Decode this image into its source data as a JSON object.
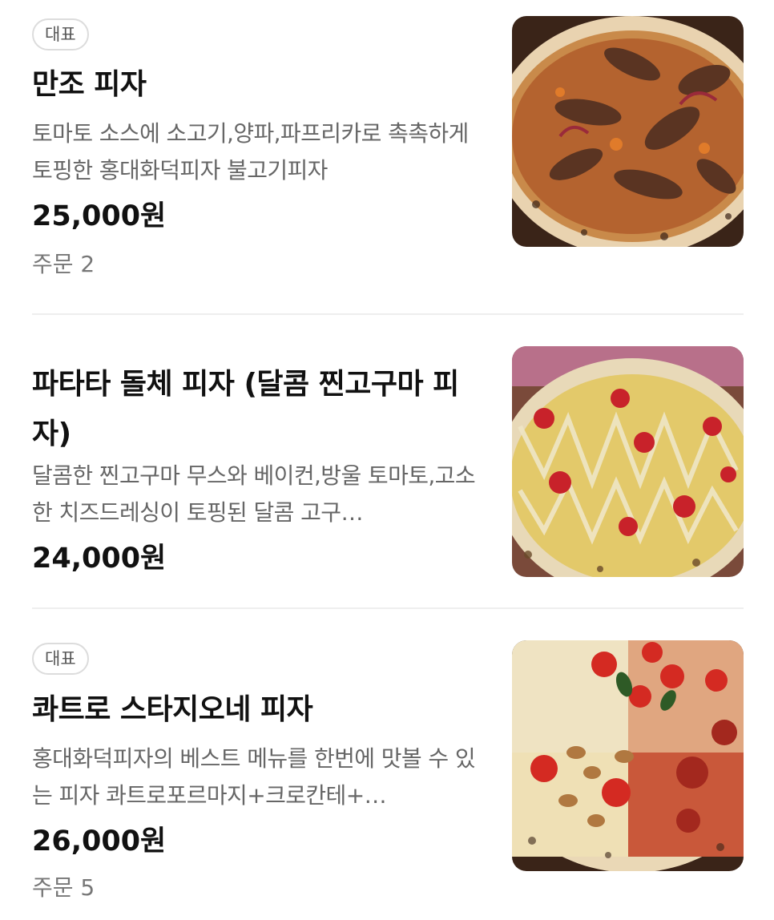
{
  "menu": {
    "items": [
      {
        "badge": "대표",
        "name": "만조 피자",
        "description": "토마토 소스에 소고기,양파,파프리카로 촉촉하게 토핑한 홍대화덕피자 불고기피자",
        "price": "25,000원",
        "orders": "주문 2",
        "image": "bulgogi-pizza-photo"
      },
      {
        "name": "파타타 돌체 피자 (달콤 찐고구마 피자)",
        "description": "달콤한 찐고구마 무스와 베이컨,방울 토마토,고소한 치즈드레싱이 토핑된 달콤 고구…",
        "price": "24,000원",
        "image": "sweet-potato-pizza-photo"
      },
      {
        "badge": "대표",
        "name": "콰트로 스타지오네 피자",
        "description": "홍대화덕피자의 베스트 메뉴를 한번에 맛볼 수 있는 피자 콰트로포르마지+크로칸테+…",
        "price": "26,000원",
        "orders": "주문 5",
        "image": "quattro-stagioni-pizza-photo"
      }
    ]
  }
}
